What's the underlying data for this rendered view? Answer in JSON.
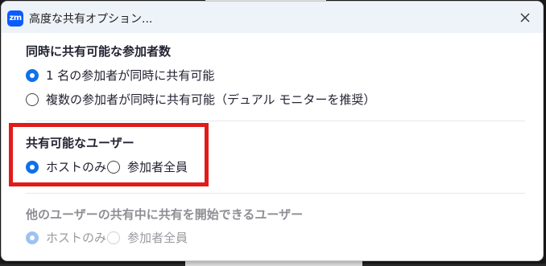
{
  "window": {
    "app_logo": "zm",
    "title": "高度な共有オプション...",
    "close_icon": "close-icon"
  },
  "simultaneous": {
    "title": "同時に共有可能な参加者数",
    "options": [
      {
        "label": "1 名の参加者が同時に共有可能",
        "checked": true
      },
      {
        "label": "複数の参加者が同時に共有可能（デュアル モニターを推奨）",
        "checked": false
      }
    ]
  },
  "who_can_share": {
    "title": "共有可能なユーザー",
    "options": [
      {
        "label": "ホストのみ",
        "checked": true
      },
      {
        "label": "参加者全員",
        "checked": false
      }
    ]
  },
  "who_can_start_while_sharing": {
    "title": "他のユーザーの共有中に共有を開始できるユーザー",
    "disabled": true,
    "options": [
      {
        "label": "ホストのみ",
        "checked": true
      },
      {
        "label": "参加者全員",
        "checked": false
      }
    ]
  },
  "colors": {
    "accent": "#0e71eb",
    "highlight": "#e21a1a",
    "titlebar": "#eef3f9"
  }
}
